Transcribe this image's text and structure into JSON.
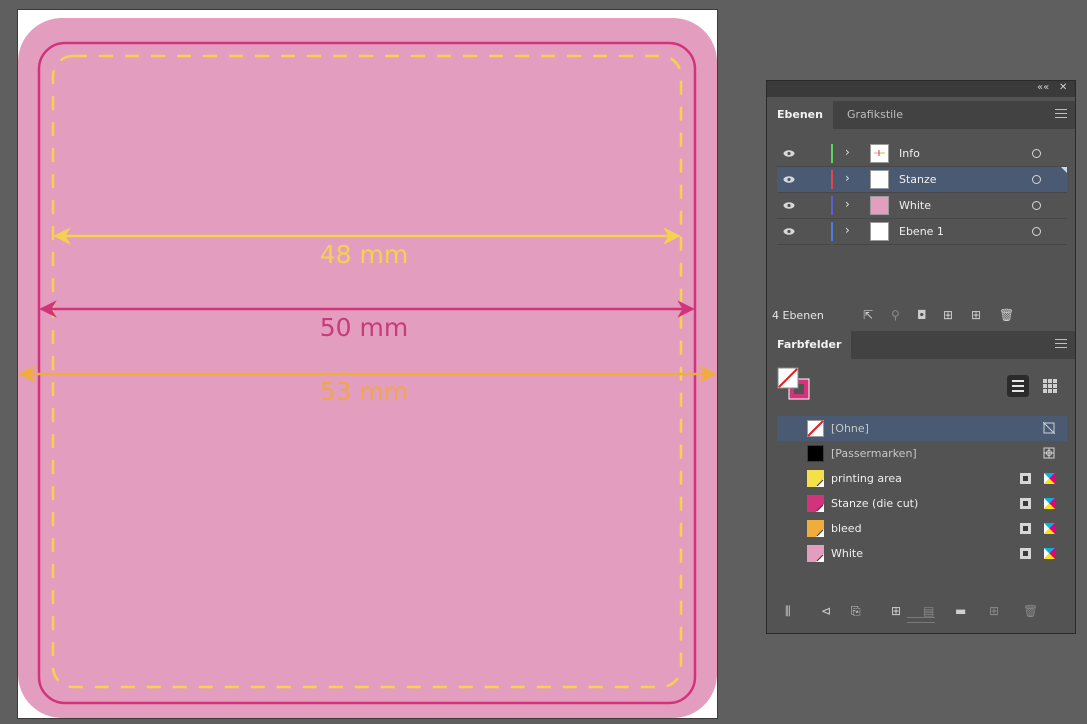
{
  "artboard": {
    "labels": {
      "printing": "48 mm",
      "diecut": "50 mm",
      "bleed": "53 mm"
    },
    "colors": {
      "bleed_fill": "#e39ebf",
      "diecut_line": "#d2337b",
      "printing_line": "#f5d14e",
      "bleed_line": "#f0ad3c",
      "printing_text": "#f5d14e",
      "diecut_text": "#c93a78",
      "bleed_text": "#eea74a"
    }
  },
  "panel": {
    "controls": {
      "collapse": "««",
      "close": "✕"
    },
    "layers_panel": {
      "tabs": [
        "Ebenen",
        "Grafikstile"
      ],
      "layers": [
        {
          "name": "Info",
          "color": "#5fd35a",
          "thumb": "info"
        },
        {
          "name": "Stanze",
          "color": "#e0464b",
          "thumb": "white",
          "selected": true
        },
        {
          "name": "White",
          "color": "#5a5ed0",
          "thumb": "pink"
        },
        {
          "name": "Ebene 1",
          "color": "#4a7ce0",
          "thumb": "white"
        }
      ],
      "footer": {
        "count": "4 Ebenen",
        "icons": [
          "export-icon",
          "search-icon",
          "clip-icon",
          "sublayer-icon",
          "new-layer-icon",
          "trash-icon"
        ]
      }
    },
    "swatches_panel": {
      "tab": "Farbfelder",
      "swatches": [
        {
          "name": "[Ohne]",
          "type": "none",
          "icon": "no-color-icon",
          "selected": true
        },
        {
          "name": "[Passermarken]",
          "type": "registration",
          "icon": "registration-icon"
        },
        {
          "name": "printing area",
          "type": "spot",
          "color": "#f5e04a"
        },
        {
          "name": "Stanze (die cut)",
          "type": "spot",
          "color": "#d2337b"
        },
        {
          "name": "bleed",
          "type": "spot",
          "color": "#f0ad3c"
        },
        {
          "name": "White",
          "type": "spot",
          "color": "#e39ebf"
        }
      ],
      "footer": {
        "icons": [
          "library-icon",
          "show-kinds-icon",
          "swatch-options-icon",
          "color-group-icon",
          "edit-group-icon",
          "folder-icon",
          "new-swatch-icon",
          "trash-icon"
        ]
      }
    }
  }
}
